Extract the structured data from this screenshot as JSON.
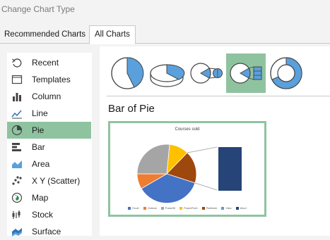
{
  "window": {
    "title": "Change Chart Type"
  },
  "tabs": {
    "recommended": "Recommended Charts",
    "all": "All Charts"
  },
  "sidebar": {
    "items": [
      {
        "label": "Recent",
        "icon": "recent-icon"
      },
      {
        "label": "Templates",
        "icon": "templates-icon"
      },
      {
        "label": "Column",
        "icon": "column-chart-icon"
      },
      {
        "label": "Line",
        "icon": "line-chart-icon"
      },
      {
        "label": "Pie",
        "icon": "pie-chart-icon",
        "selected": true
      },
      {
        "label": "Bar",
        "icon": "bar-chart-icon"
      },
      {
        "label": "Area",
        "icon": "area-chart-icon"
      },
      {
        "label": "X Y (Scatter)",
        "icon": "scatter-chart-icon"
      },
      {
        "label": "Map",
        "icon": "map-chart-icon"
      },
      {
        "label": "Stock",
        "icon": "stock-chart-icon"
      },
      {
        "label": "Surface",
        "icon": "surface-chart-icon"
      }
    ]
  },
  "subtypes": [
    {
      "icon": "pie-icon"
    },
    {
      "icon": "3d-pie-icon"
    },
    {
      "icon": "pie-of-pie-icon"
    },
    {
      "icon": "bar-of-pie-icon",
      "selected": true
    },
    {
      "icon": "doughnut-icon"
    }
  ],
  "main": {
    "subtype_title": "Bar of Pie"
  },
  "chart_data": {
    "type": "pie",
    "title": "Courses sold",
    "categories": [
      "Excel",
      "Outlook",
      "PowerBI",
      "PowerPoint",
      "Publisher",
      "Visio",
      "Word"
    ],
    "colors": [
      "#4472c4",
      "#ed7d31",
      "#a5a5a5",
      "#ffc000",
      "#9e480e",
      "#5b9bd5",
      "#264478"
    ]
  },
  "colors": {
    "accent": "#8fc3a0",
    "chart_blue": "#5aa0dc"
  }
}
